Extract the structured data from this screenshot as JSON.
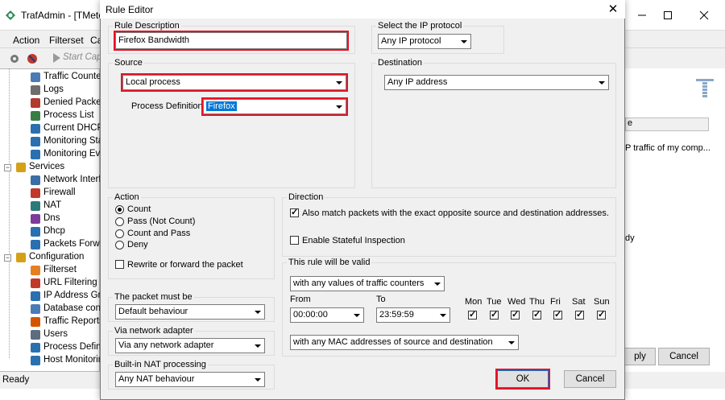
{
  "background_app": {
    "title": "TrafAdmin - [TMeter",
    "menu": [
      "Action",
      "Filterset",
      "Ca"
    ],
    "toolbar": {
      "start_capture": "Start Capt"
    },
    "tree": [
      {
        "label": "Traffic Counter",
        "icon": "counter-icon"
      },
      {
        "label": "Logs",
        "icon": "log-icon"
      },
      {
        "label": "Denied Packets",
        "icon": "denied-icon"
      },
      {
        "label": "Process List",
        "icon": "process-icon"
      },
      {
        "label": "Current DHCP",
        "icon": "dhcp-icon"
      },
      {
        "label": "Monitoring Sta",
        "icon": "monitor-icon"
      },
      {
        "label": "Monitoring Eve",
        "icon": "monitor-events-icon"
      },
      {
        "label": "Services",
        "icon": "services-icon"
      },
      {
        "label": "Network Interfa",
        "icon": "network-icon"
      },
      {
        "label": "Firewall",
        "icon": "firewall-icon"
      },
      {
        "label": "NAT",
        "icon": "nat-icon"
      },
      {
        "label": "Dns",
        "icon": "dns-icon"
      },
      {
        "label": "Dhcp",
        "icon": "dhcp-service-icon"
      },
      {
        "label": "Packets Forwar",
        "icon": "forward-icon"
      },
      {
        "label": "Configuration",
        "icon": "configuration-icon"
      },
      {
        "label": "Filterset",
        "icon": "filter-icon"
      },
      {
        "label": "URL Filtering",
        "icon": "url-filter-icon"
      },
      {
        "label": "IP Address Gro",
        "icon": "ip-group-icon"
      },
      {
        "label": "Database conn",
        "icon": "database-icon"
      },
      {
        "label": "Traffic Reports",
        "icon": "report-icon"
      },
      {
        "label": "Users",
        "icon": "users-icon"
      },
      {
        "label": "Process Definit",
        "icon": "process-def-icon"
      },
      {
        "label": "Host Monitorin",
        "icon": "host-monitor-icon"
      }
    ],
    "status": "Ready",
    "right_pane": {
      "column_header": "e",
      "row1": "P traffic of my comp...",
      "row2": "dy"
    },
    "buttons": {
      "apply": "ply",
      "cancel": "Cancel"
    }
  },
  "dialog": {
    "title": "Rule Editor",
    "rule_description": {
      "legend": "Rule Description",
      "value": "Firefox Bandwidth"
    },
    "ip_protocol": {
      "legend": "Select the IP protocol",
      "value": "Any IP protocol"
    },
    "source": {
      "legend": "Source",
      "value": "Local process",
      "process_definition_label": "Process Definition :",
      "process_definition_value": "Firefox"
    },
    "destination": {
      "legend": "Destination",
      "value": "Any IP address"
    },
    "action": {
      "legend": "Action",
      "options": [
        "Count",
        "Pass (Not Count)",
        "Count and Pass",
        "Deny"
      ],
      "selected": "Count",
      "rewrite_label": "Rewrite or forward the packet",
      "rewrite_checked": false
    },
    "direction": {
      "legend": "Direction",
      "also_match_label": "Also match packets with the exact opposite source and destination addresses.",
      "also_match_checked": true,
      "stateful_label": "Enable Stateful Inspection",
      "stateful_checked": false
    },
    "packet_must_be": {
      "legend": "The packet must be",
      "value": "Default behaviour"
    },
    "via_adapter": {
      "legend": "Via network adapter",
      "value": "Via any network adapter"
    },
    "nat_processing": {
      "legend": "Built-in NAT processing",
      "value": "Any NAT behaviour"
    },
    "validity": {
      "legend": "This rule will be valid",
      "counters_value": "with any values of traffic counters",
      "from_label": "From",
      "to_label": "To",
      "from_value": "00:00:00",
      "to_value": "23:59:59",
      "days": [
        {
          "label": "Mon",
          "checked": true
        },
        {
          "label": "Tue",
          "checked": true
        },
        {
          "label": "Wed",
          "checked": true
        },
        {
          "label": "Thu",
          "checked": true
        },
        {
          "label": "Fri",
          "checked": true
        },
        {
          "label": "Sat",
          "checked": true
        },
        {
          "label": "Sun",
          "checked": true
        }
      ],
      "mac_value": "with any MAC addresses of source and destination"
    },
    "ok_label": "OK",
    "cancel_label": "Cancel"
  },
  "colors": {
    "highlight_outline": "#e81123",
    "selection": "#0078d7",
    "dialog_bg": "#f0f0f0"
  }
}
